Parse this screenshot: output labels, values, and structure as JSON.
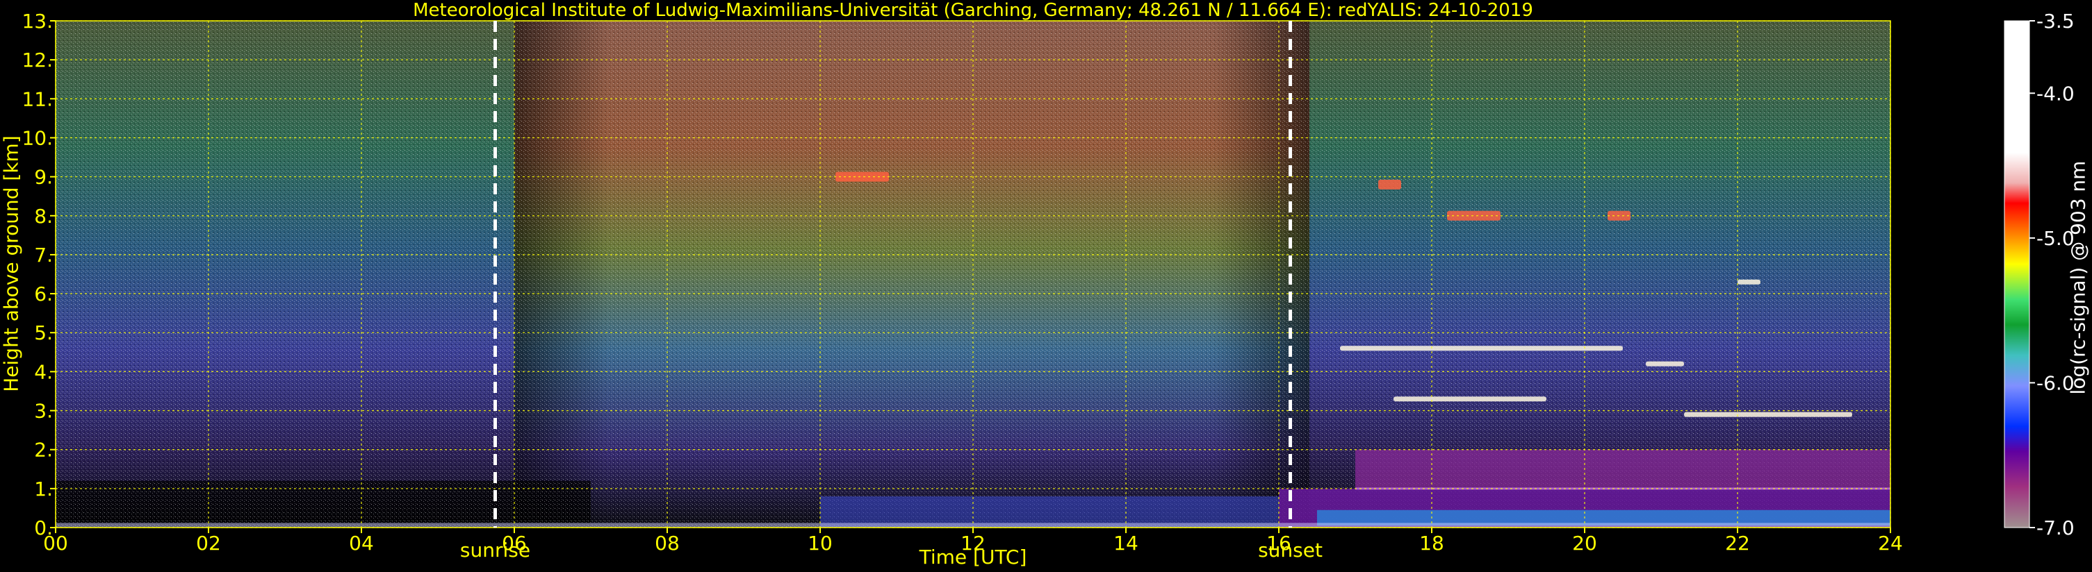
{
  "chart_data": {
    "type": "heatmap",
    "title": "Meteorological Institute of Ludwig-Maximilians-Universität (Garching, Germany; 48.261 N / 11.664 E):    redYALIS: 24-10-2019",
    "xlabel": "Time [UTC]",
    "ylabel": "Height above ground [km]",
    "xlim": [
      0,
      24
    ],
    "ylim": [
      0,
      13
    ],
    "x_ticks": [
      "00",
      "02",
      "04",
      "06",
      "08",
      "10",
      "12",
      "14",
      "16",
      "18",
      "20",
      "22",
      "24"
    ],
    "y_ticks": [
      "0.",
      "1.",
      "2.",
      "3.",
      "4.",
      "5.",
      "6.",
      "7.",
      "8.",
      "9.",
      "10.",
      "11.",
      "12.",
      "13."
    ],
    "grid": true,
    "events": [
      {
        "label": "sunrise",
        "time": 5.75
      },
      {
        "label": "sunset",
        "time": 16.15
      }
    ],
    "colorbar": {
      "label": "log(rc-signal) @ 903 nm",
      "range": [
        -7.0,
        -3.5
      ],
      "ticks": [
        "-3.5",
        "-4.0",
        "-5.0",
        "-6.0",
        "-7.0"
      ]
    },
    "features": [
      {
        "kind": "cloud",
        "t_start": 10.2,
        "t_end": 10.9,
        "height_km": 9.0
      },
      {
        "kind": "cloud",
        "t_start": 17.3,
        "t_end": 17.6,
        "height_km": 8.8
      },
      {
        "kind": "cloud",
        "t_start": 18.2,
        "t_end": 18.9,
        "height_km": 8.0
      },
      {
        "kind": "cloud",
        "t_start": 20.3,
        "t_end": 20.6,
        "height_km": 8.0
      },
      {
        "kind": "cloud",
        "t_start": 22.0,
        "t_end": 22.3,
        "height_km": 6.3
      },
      {
        "kind": "cloud",
        "t_start": 16.8,
        "t_end": 20.5,
        "height_km": 4.6
      },
      {
        "kind": "cloud",
        "t_start": 20.8,
        "t_end": 21.3,
        "height_km": 4.2
      },
      {
        "kind": "cloud",
        "t_start": 17.5,
        "t_end": 19.5,
        "height_km": 3.3
      },
      {
        "kind": "cloud",
        "t_start": 21.3,
        "t_end": 23.5,
        "height_km": 2.9
      },
      {
        "kind": "boundary_layer",
        "t_start": 17.0,
        "t_end": 24.0,
        "height_km": 1.0
      }
    ]
  },
  "colors": {
    "text_yellow": "#ffff00",
    "grid": "#ffff00",
    "background": "#000000",
    "event_line": "#ffffff"
  }
}
